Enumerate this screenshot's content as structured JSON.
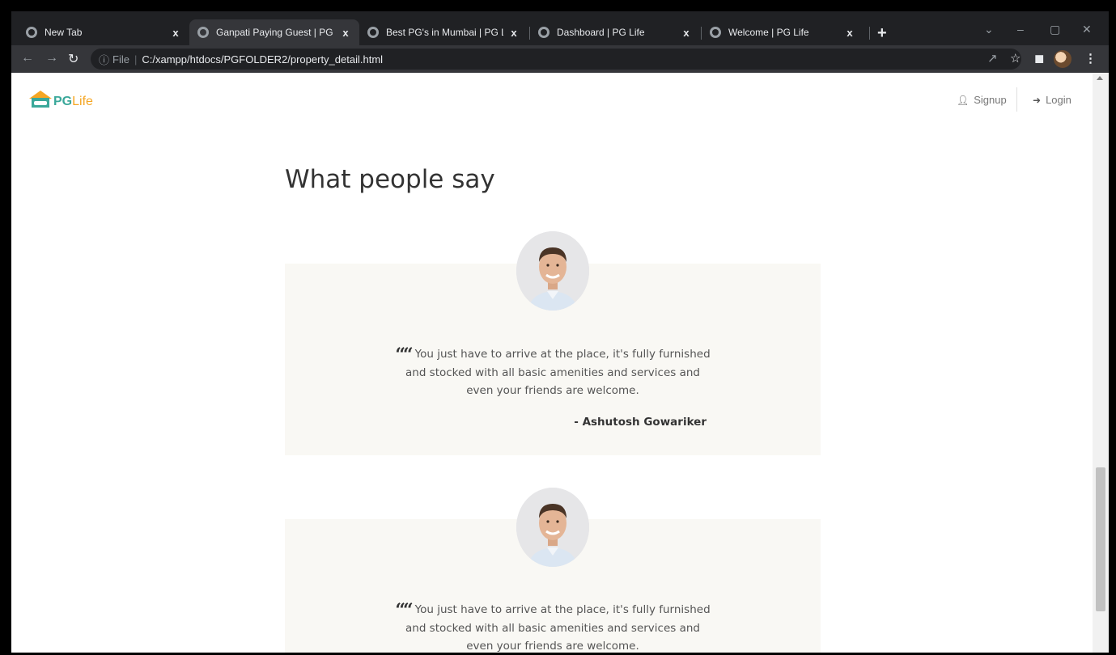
{
  "browser": {
    "tabs": [
      {
        "title": "New Tab",
        "active": false
      },
      {
        "title": "Ganpati Paying Guest | PG Life",
        "active": true
      },
      {
        "title": "Best PG's in Mumbai | PG Life",
        "active": false
      },
      {
        "title": "Dashboard | PG Life",
        "active": false
      },
      {
        "title": "Welcome | PG Life",
        "active": false
      }
    ],
    "tab_close_glyph": "x",
    "new_tab_glyph": "+",
    "address": {
      "scheme": "File",
      "divider": "|",
      "url": "C:/xampp/htdocs/PGFOLDER2/property_detail.html"
    },
    "theme_colors": {
      "tab_strip": "#202124",
      "toolbar": "#35363a"
    }
  },
  "site": {
    "logo": {
      "pg": "PG",
      "life": "Life"
    },
    "nav": {
      "signup": "Signup",
      "login": "Login"
    },
    "brand_colors": {
      "teal": "#3aa89a",
      "orange": "#f5a623"
    }
  },
  "testimonials": {
    "heading": "What people say",
    "items": [
      {
        "quote_line1": "You just have to arrive at the place, it's fully furnished",
        "quote_line2": "and stocked with all basic amenities and services and",
        "quote_line3": "even your friends are welcome.",
        "author": "- Ashutosh Gowariker"
      },
      {
        "quote_line1": "You just have to arrive at the place, it's fully furnished",
        "quote_line2": "and stocked with all basic amenities and services and",
        "quote_line3": "even your friends are welcome."
      }
    ],
    "card_background": "#f9f8f4"
  }
}
